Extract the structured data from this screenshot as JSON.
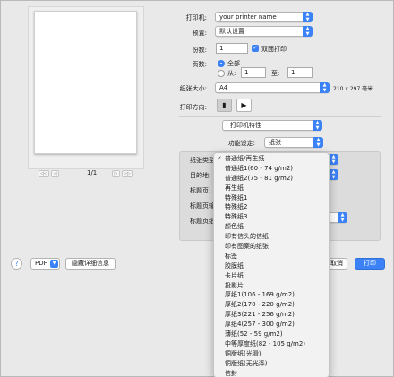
{
  "printer": {
    "label": "打印机:",
    "value": "your printer name"
  },
  "presets": {
    "label": "预置:",
    "value": "默认设置"
  },
  "copies": {
    "label": "份数:",
    "value": "1",
    "duplex_label": "双面打印"
  },
  "pages": {
    "label": "页数:",
    "all_label": "全部",
    "from_label": "从:",
    "from_value": "1",
    "to_label": "至:",
    "to_value": "1"
  },
  "paper_size": {
    "label": "纸张大小:",
    "value": "A4",
    "dims": "210 x 297 毫米"
  },
  "orientation": {
    "label": "打印方向:"
  },
  "section": {
    "value": "打印机特性"
  },
  "feature_set": {
    "label": "功能设定:",
    "value": "纸张"
  },
  "group_labels": {
    "paper_type": "纸张类型",
    "destination": "目的地:",
    "title_page": "标题页:",
    "title_page_input": "标题页输",
    "title_page_type": "标题页纸"
  },
  "preview": {
    "page_indicator": "1/1",
    "first": "◁◁",
    "prev": "◁",
    "next": "▷",
    "last": "▷▷"
  },
  "footer": {
    "help": "?",
    "pdf_label": "PDF",
    "hide_details": "隐藏详细信息",
    "cancel": "取消",
    "print": "打印"
  },
  "menu": {
    "checkmark": "✓",
    "items": [
      "普通纸/再生纸",
      "普通纸1(60 - 74 g/m2)",
      "普通纸2(75 - 81 g/m2)",
      "再生纸",
      "特殊纸1",
      "特殊纸2",
      "特殊纸3",
      "颜色纸",
      "印有信头的信纸",
      "印有图案的纸张",
      "标签",
      "胶膜纸",
      "卡片纸",
      "投影片",
      "厚纸1(106 - 169 g/m2)",
      "厚纸2(170 - 220 g/m2)",
      "厚纸3(221 - 256 g/m2)",
      "厚纸4(257 - 300 g/m2)",
      "薄纸(52 - 59 g/m2)",
      "中等厚度纸(82 - 105 g/m2)",
      "铜版纸(光滑)",
      "铜版纸(无光泽)",
      "信封",
      "无"
    ]
  },
  "colors": {
    "accent": "#3b82f6",
    "window_bg": "#e9e9e9",
    "menu_bg": "#f2f2f2"
  }
}
